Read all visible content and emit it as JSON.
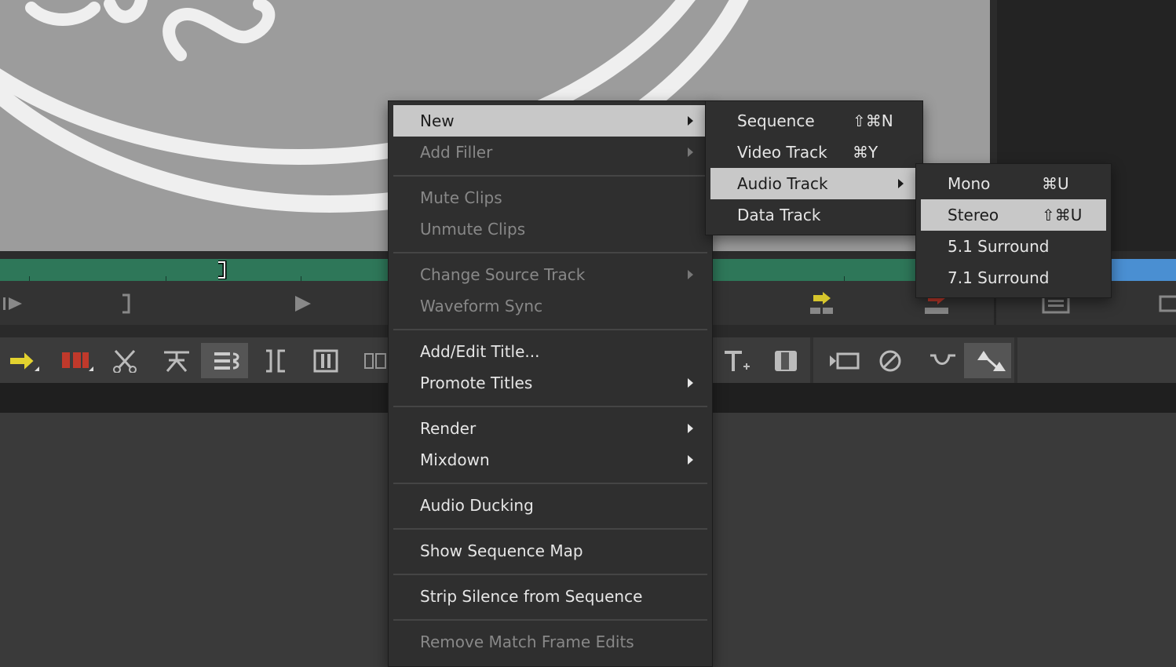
{
  "context_menu": {
    "items": [
      {
        "label": "New",
        "state": "highlighted",
        "submenu": true
      },
      {
        "label": "Add Filler",
        "state": "disabled",
        "submenu": true
      },
      {
        "label": "Mute Clips",
        "state": "disabled"
      },
      {
        "label": "Unmute Clips",
        "state": "disabled"
      },
      {
        "label": "Change Source Track",
        "state": "disabled",
        "submenu": true
      },
      {
        "label": "Waveform Sync",
        "state": "disabled"
      },
      {
        "label": "Add/Edit Title...",
        "state": "enabled"
      },
      {
        "label": "Promote Titles",
        "state": "enabled",
        "submenu": true
      },
      {
        "label": "Render",
        "state": "enabled",
        "submenu": true
      },
      {
        "label": "Mixdown",
        "state": "enabled",
        "submenu": true
      },
      {
        "label": "Audio Ducking",
        "state": "enabled"
      },
      {
        "label": "Show Sequence Map",
        "state": "enabled"
      },
      {
        "label": "Strip Silence from Sequence",
        "state": "enabled"
      },
      {
        "label": "Remove Match Frame Edits",
        "state": "disabled"
      }
    ]
  },
  "new_submenu": {
    "items": [
      {
        "label": "Sequence",
        "shortcut": "⇧⌘N"
      },
      {
        "label": "Video Track",
        "shortcut": "⌘Y"
      },
      {
        "label": "Audio Track",
        "submenu": true,
        "state": "highlighted"
      },
      {
        "label": "Data Track"
      }
    ]
  },
  "audio_track_submenu": {
    "items": [
      {
        "label": "Mono",
        "shortcut": "⌘U"
      },
      {
        "label": "Stereo",
        "shortcut": "⇧⌘U",
        "state": "highlighted"
      },
      {
        "label": "5.1 Surround"
      },
      {
        "label": "7.1 Surround"
      }
    ]
  },
  "icons": {
    "transport": [
      "play-from-mark-icon",
      "mark-out-icon",
      "play-icon",
      "splice-in-icon",
      "overwrite-icon",
      "list-icon",
      "film-icon"
    ],
    "toolbar": [
      "segment-mode-yellow-icon",
      "segment-mode-red-icon",
      "scissors-icon",
      "lift-icon",
      "link-selection-icon",
      "trim-left-icon",
      "trim-both-icon",
      "slip-icon",
      "title-tool-icon",
      "effect-tool-icon",
      "render-icon",
      "no-icon",
      "smooth-icon",
      "keyframe-icon"
    ]
  },
  "colors": {
    "menu_bg": "#2f2f2f",
    "highlight": "#c8c8c8",
    "position_bar": "#2e7759",
    "position_bar_blue": "#4a8fd2",
    "viewer_bg": "#9c9c9c"
  }
}
